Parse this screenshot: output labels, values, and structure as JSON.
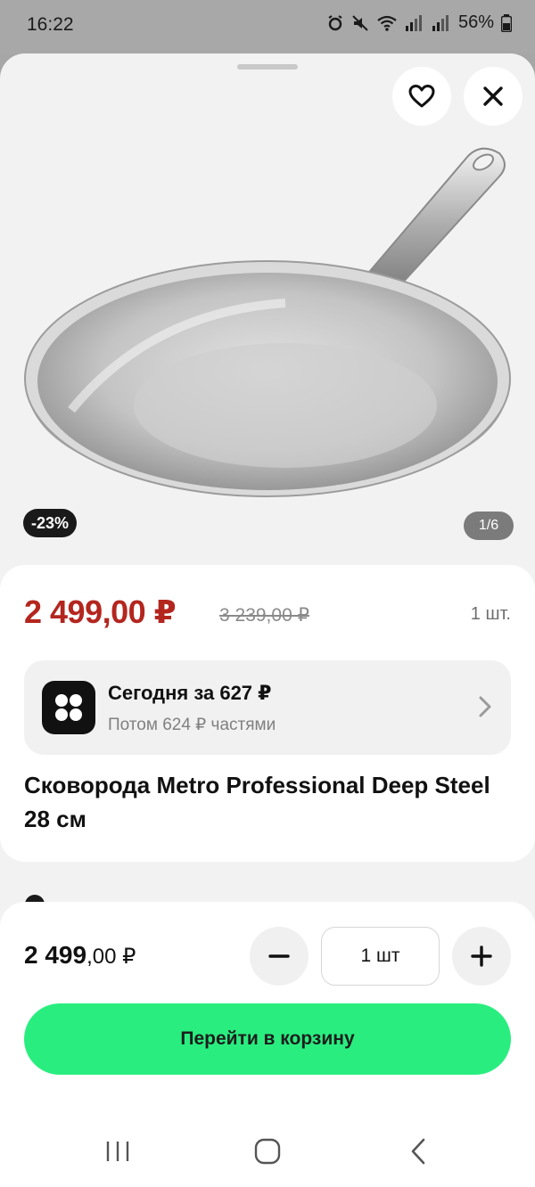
{
  "status_bar": {
    "time": "16:22",
    "battery": "56%"
  },
  "gallery": {
    "discount_badge": "-23%",
    "counter": "1/6"
  },
  "product": {
    "price_current": "2 499,00 ₽",
    "price_old": "3 239,00 ₽",
    "unit": "1 шт.",
    "title": "Сковорода Metro Professional Deep Steel 28 см"
  },
  "split": {
    "title": "Сегодня за 627 ₽",
    "subtitle": "Потом 624 ₽ частями"
  },
  "bottom_bar": {
    "total_main": "2 499",
    "total_cents": ",00 ₽",
    "quantity": "1 шт",
    "cart_button_label": "Перейти в корзину"
  },
  "colors": {
    "price_red": "#b3261e",
    "cart_button_green": "#29ee7f"
  }
}
